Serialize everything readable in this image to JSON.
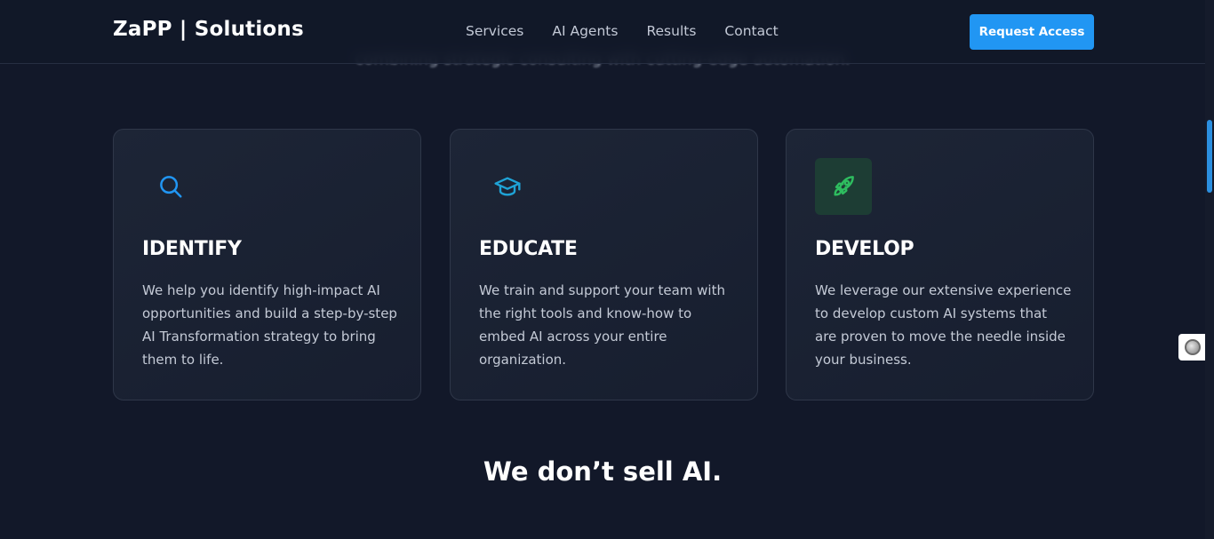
{
  "hero": {
    "subtitle": "combining strategic consulting with cutting-edge automation."
  },
  "header": {
    "brand": "ZaPP | Solutions",
    "nav": [
      "Services",
      "AI Agents",
      "Results",
      "Contact"
    ],
    "cta_label": "Request Access"
  },
  "cards": [
    {
      "title": "IDENTIFY",
      "icon": "search-icon",
      "text": "We help you identify high-impact AI opportunities and build a step-by-step AI Transformation strategy to bring them to life."
    },
    {
      "title": "EDUCATE",
      "icon": "graduation-cap-icon",
      "text": "We train and support your team with the right tools and know-how to embed AI across your entire organization."
    },
    {
      "title": "DEVELOP",
      "icon": "rocket-icon",
      "text": "We leverage our extensive experience to develop custom AI systems that are proven to move the needle inside your business."
    }
  ],
  "tagline": "We don’t sell AI.",
  "colors": {
    "background": "#121829",
    "accent": "#2196f3",
    "educate_icon": "#1fa3d6",
    "develop_icon": "#2ebd5f"
  }
}
